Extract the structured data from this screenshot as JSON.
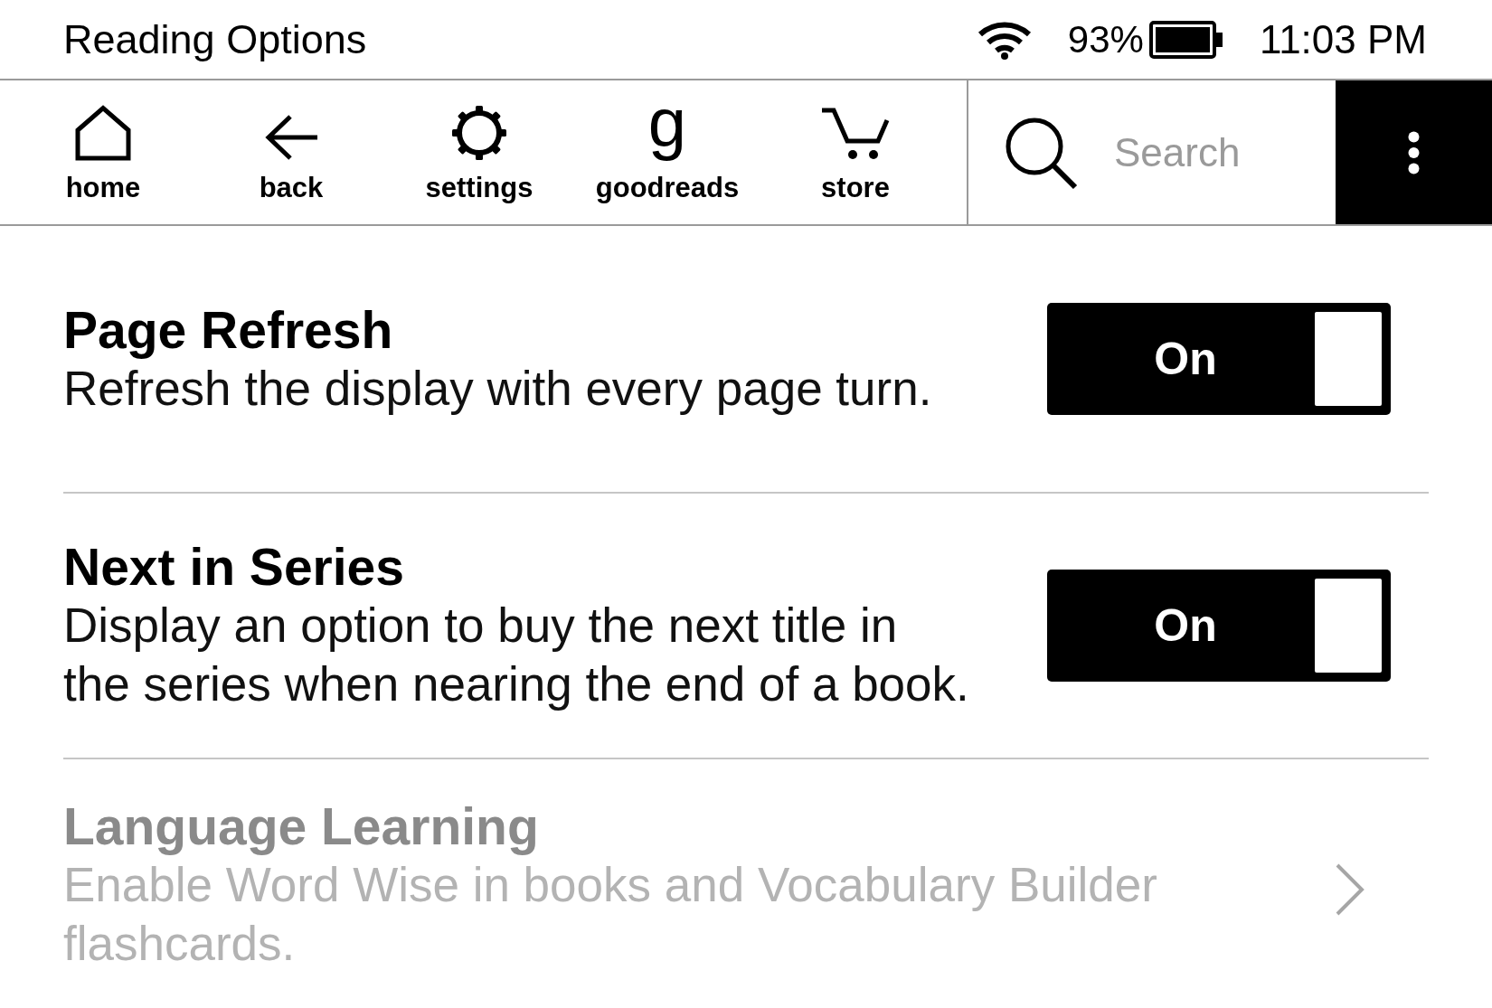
{
  "status_bar": {
    "title": "Reading Options",
    "battery": "93%",
    "time": "11:03 PM"
  },
  "toolbar": {
    "items": [
      {
        "kind": "home",
        "label": "home"
      },
      {
        "kind": "back",
        "label": "back"
      },
      {
        "kind": "settings",
        "label": "settings"
      },
      {
        "kind": "goodreads",
        "label": "goodreads",
        "glyph": "g"
      },
      {
        "kind": "store",
        "label": "store"
      }
    ],
    "search": {
      "placeholder": "Search"
    }
  },
  "settings": [
    {
      "kind": "toggle",
      "title": "Page Refresh",
      "description": "Refresh the display with every page turn.",
      "disabled": false,
      "on": true,
      "toggle_label": "On"
    },
    {
      "kind": "toggle",
      "title": "Next in Series",
      "description": "Display an option to buy the next title in the series when nearing the end of a book.",
      "disabled": false,
      "on": true,
      "toggle_label": "On"
    },
    {
      "kind": "link",
      "title": "Language Learning",
      "description": "Enable Word Wise in books and Vocabulary Builder flashcards.",
      "disabled": true
    }
  ]
}
